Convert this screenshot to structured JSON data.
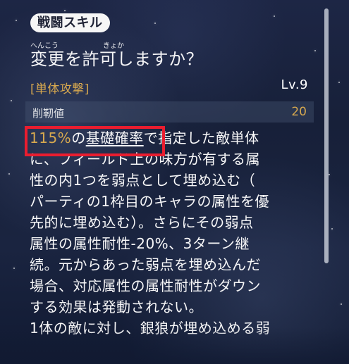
{
  "skill_tag": "戦闘スキル",
  "ruby": [
    "へんこう",
    "きょか"
  ],
  "title": "変更を許可しますか？",
  "target": "[単体攻撃]",
  "level": "Lv.9",
  "stat": {
    "label": "削靭値",
    "value": "20"
  },
  "description": {
    "line1": {
      "percent": "115%",
      "particle": "の",
      "underlined": "基礎確率",
      "rest": "で指定した敵単体"
    },
    "line2": "に、フィールド上の味方が有する属",
    "line3": "性の内1つを弱点として埋め込む（",
    "line4": "パーティの1枠目のキャラの属性を優",
    "line5": "先的に埋め込む）。さらにその弱点",
    "line6": "属性の属性耐性-20%、3ターン継",
    "line7": "続。元からあった弱点を埋め込んだ",
    "line8": "場合、対応属性の属性耐性がダウン",
    "line9": "する効果は発動されない。",
    "line10": "1体の敵に対し、銀狼が埋め込める弱"
  },
  "colors": {
    "accent": "#d6a84f",
    "highlight": "#ea1d2f",
    "background": "#1a2440"
  }
}
